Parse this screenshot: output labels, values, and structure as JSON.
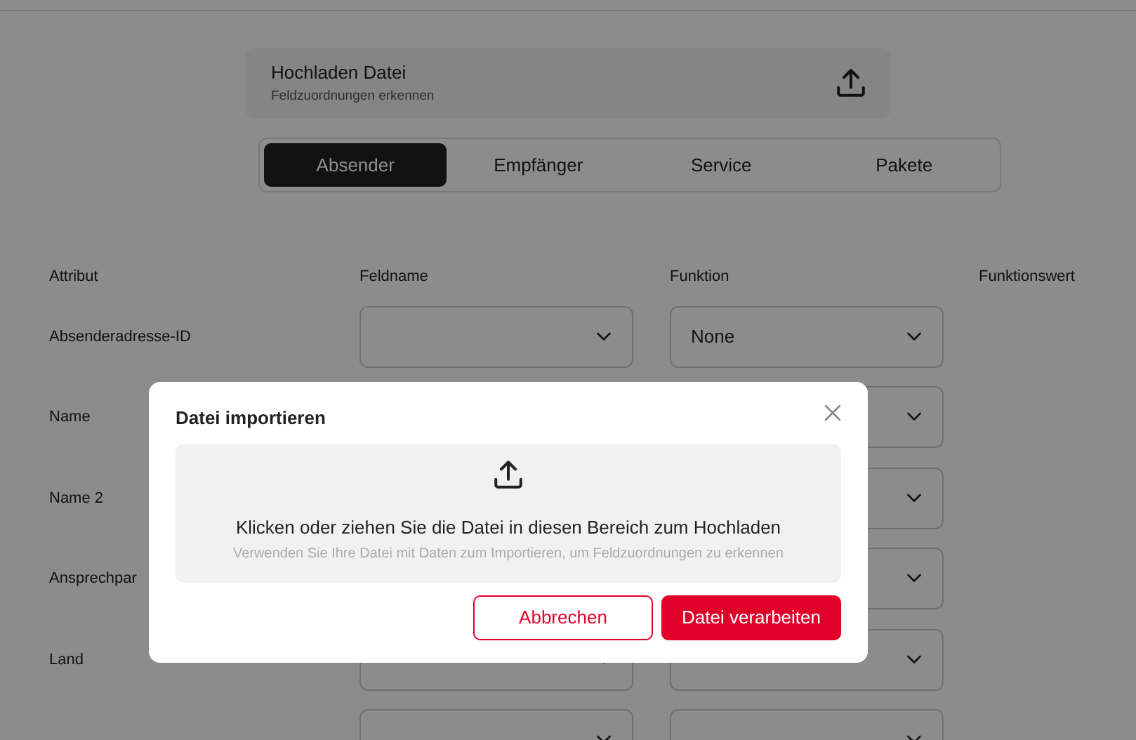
{
  "upload_card": {
    "title": "Hochladen Datei",
    "subtitle": "Feldzuordnungen erkennen"
  },
  "tabs": [
    {
      "label": "Absender",
      "selected": true
    },
    {
      "label": "Empfänger",
      "selected": false
    },
    {
      "label": "Service",
      "selected": false
    },
    {
      "label": "Pakete",
      "selected": false
    }
  ],
  "mapping_table": {
    "columns": [
      "Attribut",
      "Feldname",
      "Funktion",
      "Funktionswert"
    ],
    "rows": [
      {
        "attribute": "Absenderadresse-ID",
        "function": "None"
      },
      {
        "attribute": "Name"
      },
      {
        "attribute": "Name 2"
      },
      {
        "attribute": "Ansprechpar"
      },
      {
        "attribute": "Land"
      },
      {}
    ]
  },
  "modal": {
    "title": "Datei importieren",
    "dropzone": {
      "text": "Klicken oder ziehen Sie die Datei in diesen Bereich zum Hochladen",
      "hint": "Verwenden Sie Ihre Datei mit Daten zum Importieren, um Feldzuordnungen zu erkennen"
    },
    "buttons": [
      {
        "label": "Abbrechen",
        "kind": "secondary"
      },
      {
        "label": "Datei verarbeiten",
        "kind": "primary"
      }
    ]
  }
}
